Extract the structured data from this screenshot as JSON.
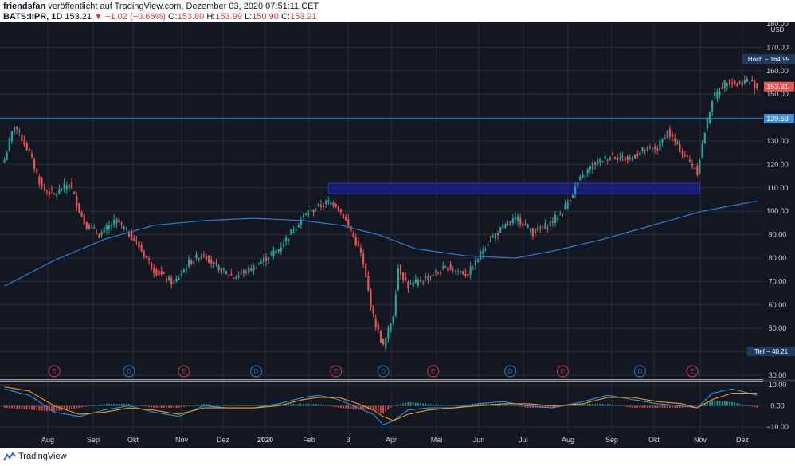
{
  "header": {
    "author": "friendsfan",
    "published": "veröffentlicht auf TradingView.com, Dezember 03, 2020 07:51:11 CET",
    "symbol": "BATS:IIPR, 1D",
    "last": "153.21",
    "change": "▼ −1.02 (−0.66%)",
    "o_label": "O:",
    "o_value": "153.80",
    "h_label": "H:",
    "h_value": "153.99",
    "l_label": "L:",
    "l_value": "150.90",
    "c_label": "C:",
    "c_value": "153.21"
  },
  "footer": {
    "brand": "TradingView"
  },
  "colors": {
    "background": "#131722",
    "grid": "#2a2e39",
    "up": "#26a69a",
    "down": "#ef5350",
    "ma": "#2f7ed8",
    "hline": "#3d8fd6",
    "zone": "#1a1f8c",
    "macd": "#2196f3",
    "signal": "#ff9800",
    "axis_text": "#d1d4dc",
    "earnings": "#b23a3a",
    "dividend": "#2b6cb0"
  },
  "chart_data": [
    {
      "type": "candlestick",
      "title": "",
      "ylabel": "USD",
      "ylim": [
        28,
        180
      ],
      "y_ticks": [
        "30.00",
        "40.00",
        "50.00",
        "60.00",
        "70.00",
        "80.00",
        "90.00",
        "100.00",
        "110.00",
        "120.00",
        "130.00",
        "140.00",
        "150.00",
        "160.00",
        "170.00",
        "180.00"
      ],
      "x_ticks": [
        "Aug",
        "Sep",
        "Okt",
        "Nov",
        "Dez",
        "2020",
        "Feb",
        "3",
        "Apr",
        "Mai",
        "Jun",
        "Jul",
        "Aug",
        "Sep",
        "Okt",
        "Nov",
        "Dez"
      ],
      "bars_per_month": 21,
      "start": "2019-07-08",
      "anchors": [
        [
          0,
          122
        ],
        [
          4,
          137
        ],
        [
          10,
          125
        ],
        [
          15,
          110
        ],
        [
          20,
          107
        ],
        [
          26,
          112
        ],
        [
          32,
          95
        ],
        [
          38,
          90
        ],
        [
          45,
          96
        ],
        [
          52,
          88
        ],
        [
          60,
          75
        ],
        [
          68,
          69
        ],
        [
          74,
          78
        ],
        [
          80,
          82
        ],
        [
          85,
          76
        ],
        [
          92,
          72
        ],
        [
          100,
          76
        ],
        [
          110,
          84
        ],
        [
          120,
          98
        ],
        [
          126,
          102
        ],
        [
          130,
          104
        ],
        [
          133,
          103
        ],
        [
          136,
          98
        ],
        [
          143,
          82
        ],
        [
          148,
          55
        ],
        [
          152,
          42
        ],
        [
          156,
          56
        ],
        [
          158,
          76
        ],
        [
          162,
          68
        ],
        [
          170,
          72
        ],
        [
          178,
          76
        ],
        [
          186,
          73
        ],
        [
          194,
          87
        ],
        [
          200,
          93
        ],
        [
          206,
          97
        ],
        [
          212,
          91
        ],
        [
          218,
          94
        ],
        [
          224,
          100
        ],
        [
          230,
          112
        ],
        [
          236,
          120
        ],
        [
          244,
          124
        ],
        [
          250,
          122
        ],
        [
          256,
          126
        ],
        [
          262,
          127
        ],
        [
          266,
          134
        ],
        [
          270,
          128
        ],
        [
          275,
          121
        ],
        [
          278,
          117
        ],
        [
          281,
          134
        ],
        [
          284,
          148
        ],
        [
          290,
          156
        ],
        [
          294,
          154
        ],
        [
          298,
          156
        ],
        [
          302,
          153
        ]
      ],
      "series": [
        {
          "name": "",
          "type": "line",
          "anchors": [
            [
              0,
              68
            ],
            [
              20,
              79
            ],
            [
              40,
              88
            ],
            [
              60,
              94
            ],
            [
              80,
              96
            ],
            [
              100,
              97
            ],
            [
              120,
              96
            ],
            [
              135,
              94
            ],
            [
              150,
              90
            ],
            [
              165,
              84
            ],
            [
              185,
              81
            ],
            [
              205,
              80
            ],
            [
              220,
              83
            ],
            [
              240,
              88
            ],
            [
              260,
              94
            ],
            [
              280,
              100
            ],
            [
              300,
              104
            ]
          ]
        }
      ],
      "annotations": [
        {
          "type": "hline",
          "value": 139.53,
          "label": "139.53"
        },
        {
          "type": "zone",
          "from": 107.5,
          "to": 112,
          "x_start": 130,
          "x_end": 279
        },
        {
          "type": "label",
          "value": 164.99,
          "text": "Hoch − 164.99"
        },
        {
          "type": "label",
          "value": 40.21,
          "text": "Tief − 40.21"
        },
        {
          "type": "price",
          "value": 153.21,
          "text": "153.21"
        }
      ],
      "events": [
        {
          "kind": "E",
          "x": 20
        },
        {
          "kind": "D",
          "x": 50
        },
        {
          "kind": "E",
          "x": 72
        },
        {
          "kind": "D",
          "x": 101
        },
        {
          "kind": "E",
          "x": 133
        },
        {
          "kind": "D",
          "x": 152
        },
        {
          "kind": "E",
          "x": 172
        },
        {
          "kind": "D",
          "x": 203
        },
        {
          "kind": "E",
          "x": 224
        },
        {
          "kind": "D",
          "x": 255
        },
        {
          "kind": "E",
          "x": 276
        }
      ]
    },
    {
      "type": "line",
      "title": "",
      "ylim": [
        -12,
        12
      ],
      "y_ticks": [
        "10.00",
        "0.00",
        "−10.00"
      ],
      "series": [
        {
          "name": "",
          "anchors": [
            [
              0,
              8
            ],
            [
              10,
              5
            ],
            [
              20,
              -3
            ],
            [
              30,
              -5
            ],
            [
              40,
              -2
            ],
            [
              50,
              0
            ],
            [
              60,
              -3
            ],
            [
              70,
              -5
            ],
            [
              80,
              0
            ],
            [
              90,
              -1
            ],
            [
              100,
              -1
            ],
            [
              110,
              1
            ],
            [
              120,
              4
            ],
            [
              126,
              5
            ],
            [
              134,
              3
            ],
            [
              142,
              -1
            ],
            [
              148,
              -4
            ],
            [
              152,
              -9
            ],
            [
              156,
              -7
            ],
            [
              162,
              -2
            ],
            [
              170,
              -1
            ],
            [
              180,
              -1
            ],
            [
              190,
              1
            ],
            [
              200,
              2
            ],
            [
              210,
              0
            ],
            [
              220,
              -1
            ],
            [
              232,
              2
            ],
            [
              242,
              5
            ],
            [
              252,
              3
            ],
            [
              262,
              1
            ],
            [
              272,
              0
            ],
            [
              278,
              -1
            ],
            [
              284,
              6
            ],
            [
              292,
              8
            ],
            [
              302,
              5
            ]
          ]
        },
        {
          "name": "",
          "anchors": [
            [
              0,
              9
            ],
            [
              10,
              7
            ],
            [
              20,
              0
            ],
            [
              30,
              -4
            ],
            [
              40,
              -3
            ],
            [
              50,
              -1
            ],
            [
              60,
              -2
            ],
            [
              70,
              -4
            ],
            [
              80,
              -1
            ],
            [
              90,
              -1
            ],
            [
              100,
              -1
            ],
            [
              110,
              0
            ],
            [
              120,
              3
            ],
            [
              126,
              4
            ],
            [
              134,
              4
            ],
            [
              142,
              1
            ],
            [
              148,
              -2
            ],
            [
              152,
              -5
            ],
            [
              156,
              -7
            ],
            [
              162,
              -4
            ],
            [
              170,
              -2
            ],
            [
              180,
              -1
            ],
            [
              190,
              0
            ],
            [
              200,
              1
            ],
            [
              210,
              1
            ],
            [
              220,
              0
            ],
            [
              232,
              1
            ],
            [
              242,
              4
            ],
            [
              252,
              4
            ],
            [
              262,
              2
            ],
            [
              272,
              1
            ],
            [
              278,
              -1
            ],
            [
              284,
              3
            ],
            [
              292,
              6
            ],
            [
              302,
              6
            ]
          ]
        }
      ]
    }
  ]
}
